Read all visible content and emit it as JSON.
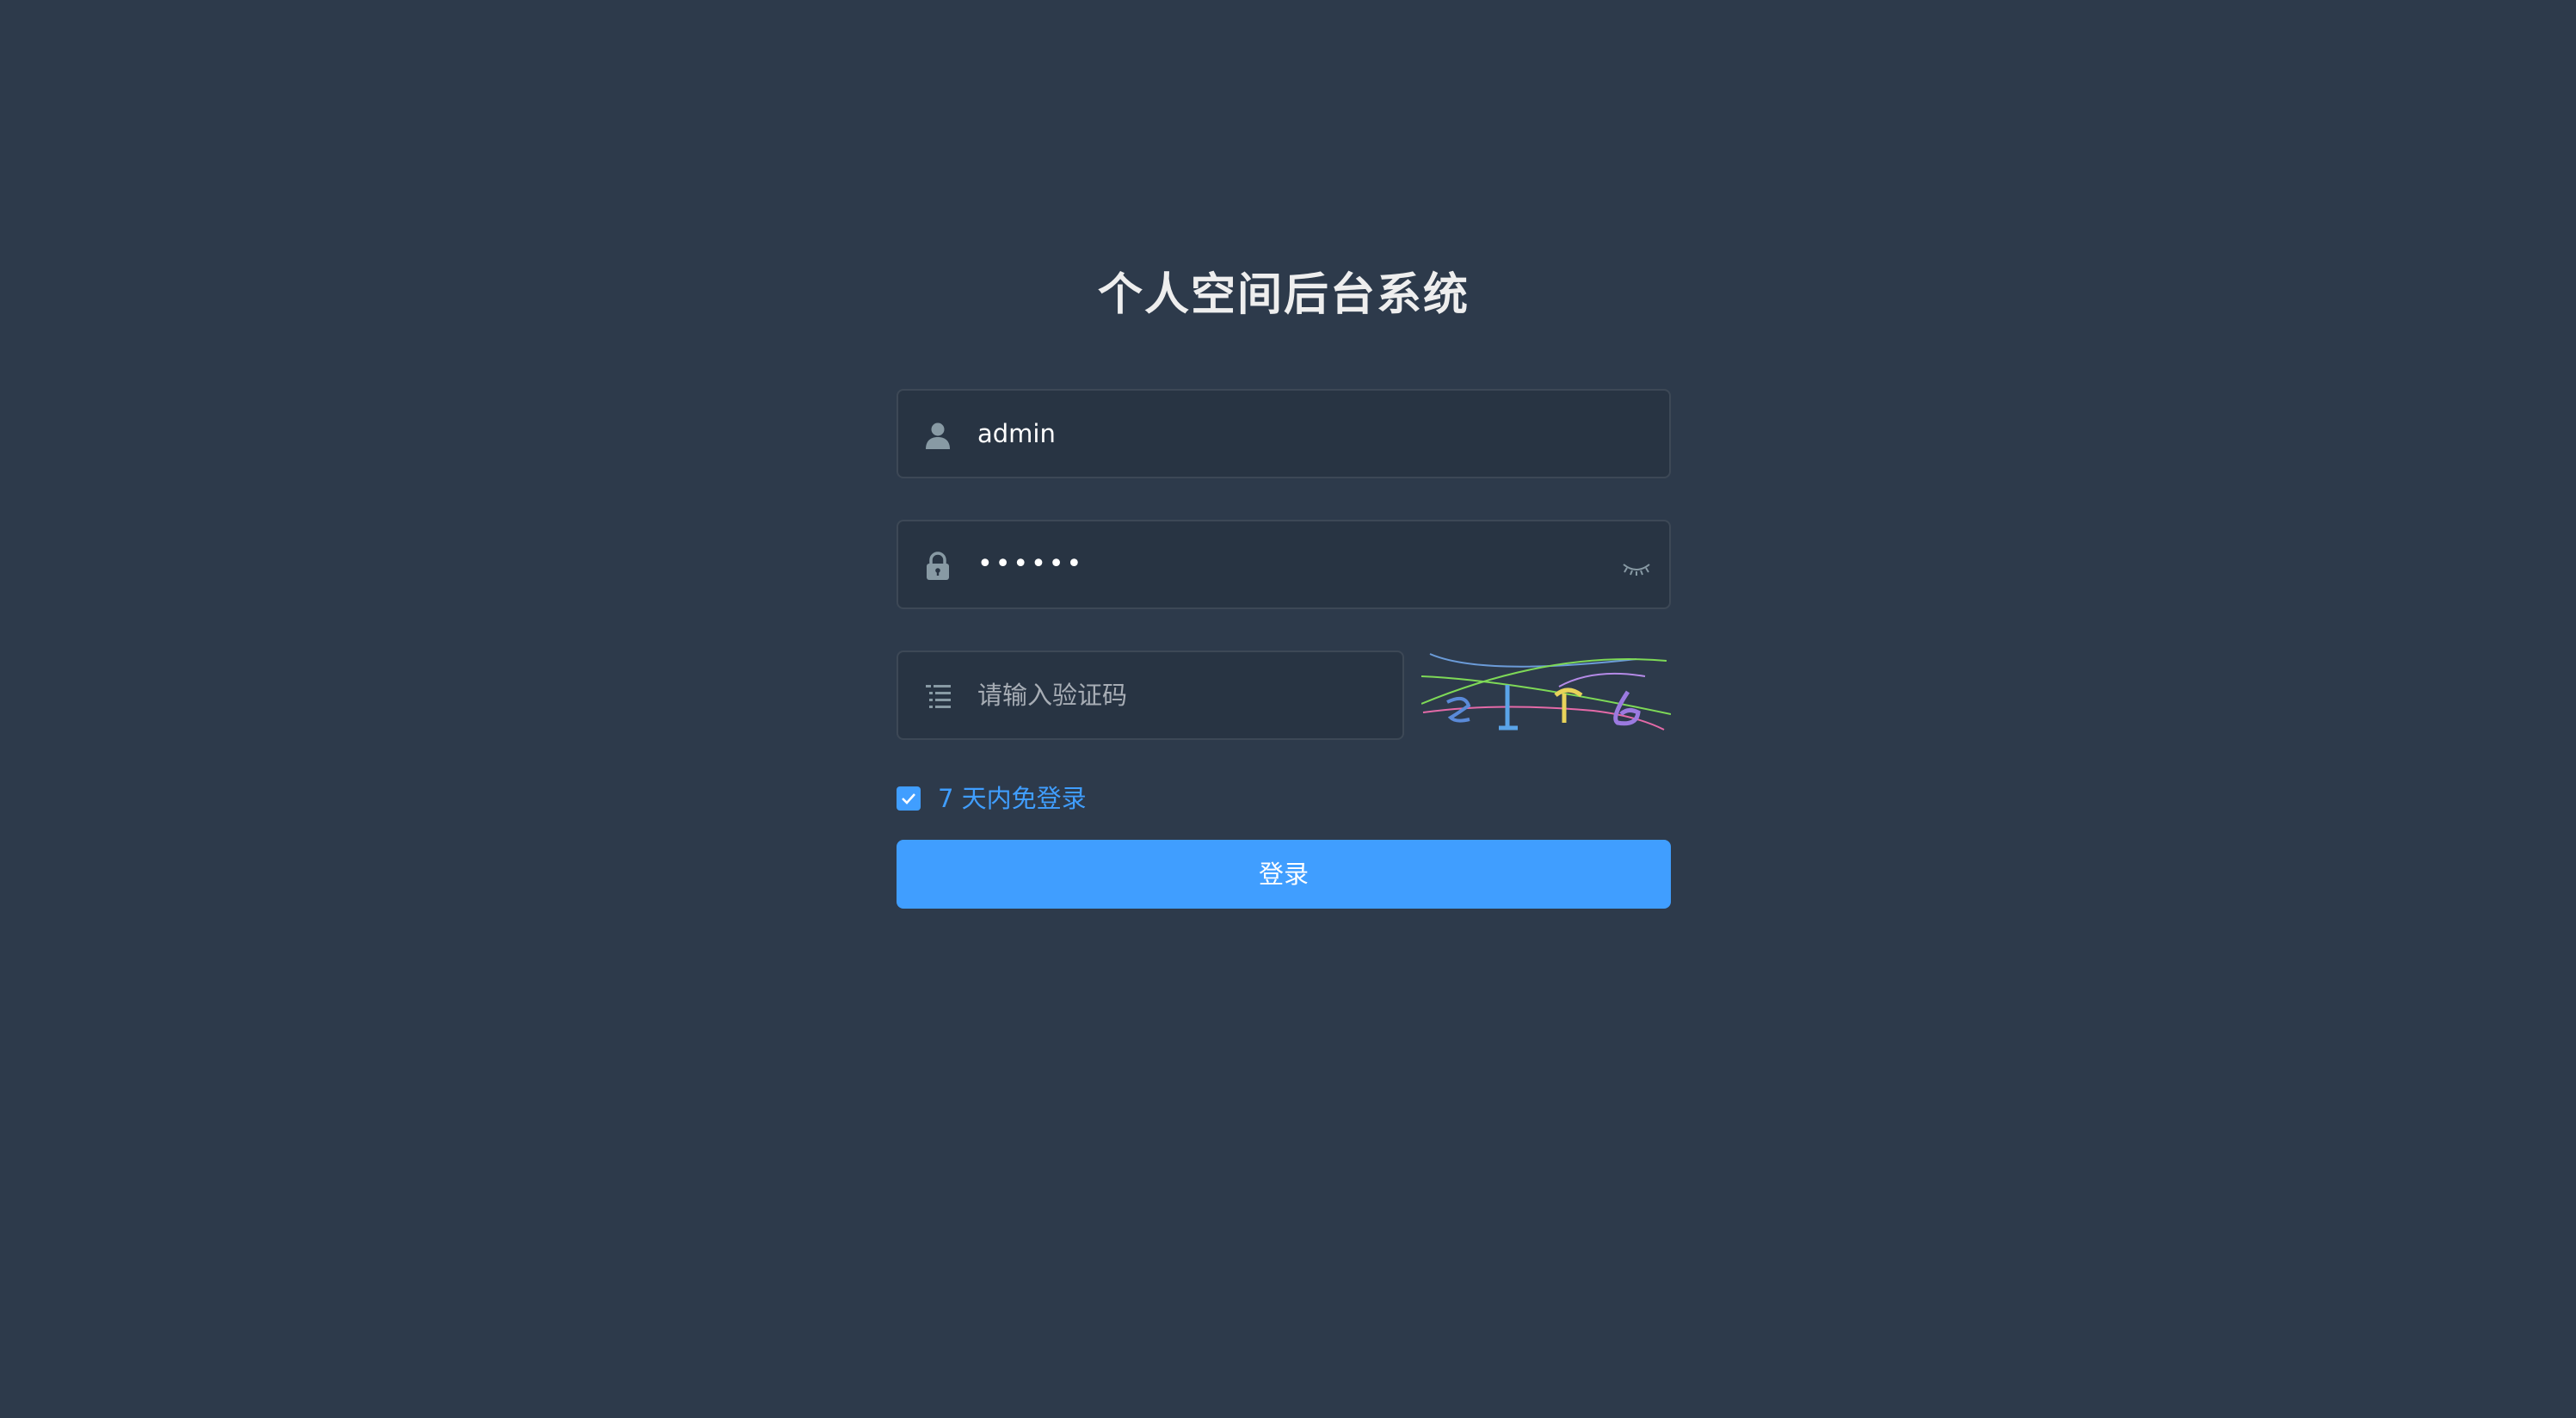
{
  "page": {
    "title": "个人空间后台系统"
  },
  "form": {
    "username": {
      "value": "admin",
      "icon": "user-icon"
    },
    "password": {
      "value": "••••••",
      "icon": "lock-icon",
      "toggle_icon": "eye-closed-icon"
    },
    "captcha": {
      "placeholder": "请输入验证码",
      "icon": "list-icon",
      "image": "captcha-image"
    },
    "remember": {
      "checked": true,
      "label": "7 天内免登录"
    },
    "submit_label": "登录"
  },
  "colors": {
    "background": "#2d3a4b",
    "input_background": "#283443",
    "accent": "#409eff",
    "title": "#eeeeee"
  }
}
